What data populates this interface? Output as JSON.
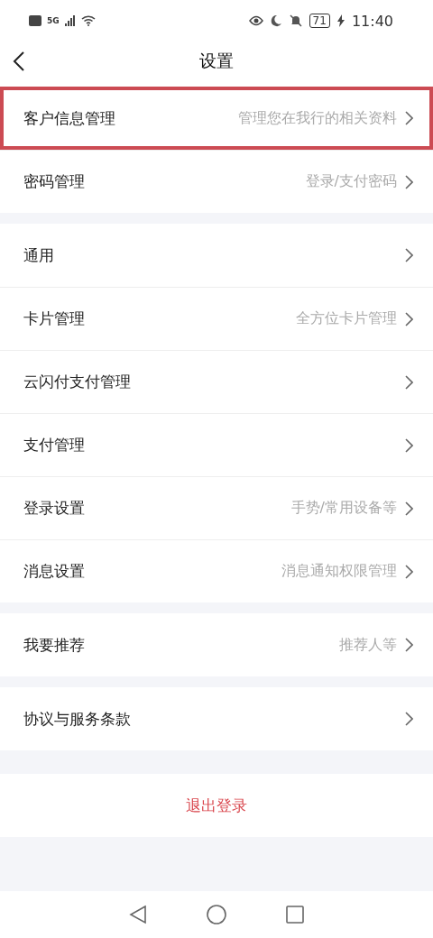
{
  "status_bar": {
    "time": "11:40",
    "battery": "71",
    "network": "5G"
  },
  "nav": {
    "title": "设置"
  },
  "groups": [
    {
      "items": [
        {
          "label": "客户信息管理",
          "hint": "管理您在我行的相关资料",
          "highlighted": true
        },
        {
          "label": "密码管理",
          "hint": "登录/支付密码",
          "highlighted": false
        }
      ]
    },
    {
      "items": [
        {
          "label": "通用",
          "highlighted": false
        },
        {
          "label": "卡片管理",
          "hint": "全方位卡片管理",
          "highlighted": false
        },
        {
          "label": "云闪付支付管理",
          "highlighted": false
        },
        {
          "label": "支付管理",
          "highlighted": false
        },
        {
          "label": "登录设置",
          "hint": "手势/常用设备等",
          "highlighted": false
        },
        {
          "label": "消息设置",
          "hint": "消息通知权限管理",
          "highlighted": false
        }
      ]
    },
    {
      "items": [
        {
          "label": "我要推荐",
          "hint": "推荐人等",
          "highlighted": false
        }
      ]
    },
    {
      "items": [
        {
          "label": "协议与服务条款",
          "highlighted": false
        }
      ]
    }
  ],
  "logout": "退出登录"
}
